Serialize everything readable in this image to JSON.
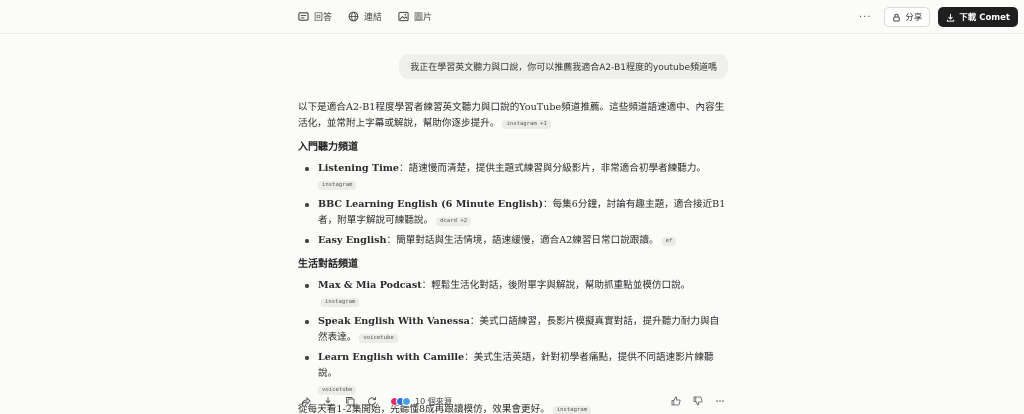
{
  "header": {
    "tabs": [
      {
        "label": "回答",
        "icon": "answer-icon"
      },
      {
        "label": "連結",
        "icon": "globe-icon"
      },
      {
        "label": "圖片",
        "icon": "image-icon"
      }
    ],
    "more_label": "···",
    "share_label": "分享",
    "download_label": "下載 Comet"
  },
  "query": "我正在學習英文聽力與口說，你可以推薦我適合A2-B1程度的youtube頻道嗎",
  "answer": {
    "intro": "以下是適合A2-B1程度學習者練習英文聽力與口說的YouTube頻道推薦。這些頻道語速適中、內容生活化，並常附上字幕或解說，幫助你逐步提升。",
    "intro_cite": "instagram +1",
    "sections": [
      {
        "title": "入門聽力頻道",
        "items": [
          {
            "name": "Listening Time",
            "desc": "：語速慢而清楚，提供主題式練習與分級影片，非常適合初學者練聽力。",
            "cite": "instagram"
          },
          {
            "name": "BBC Learning English (6 Minute English)",
            "desc": "：每集6分鐘，討論有趣主題，適合接近B1者，附單字解說可練聽說。",
            "cite": "dcard +2"
          },
          {
            "name": "Easy English",
            "desc": "：簡單對話與生活情境，語速緩慢，適合A2練習日常口說跟讀。",
            "cite": "ef"
          }
        ]
      },
      {
        "title": "生活對話頻道",
        "items": [
          {
            "name": "Max & Mia Podcast",
            "desc": "：輕鬆生活化對話，後附單字與解說，幫助抓重點並模仿口說。",
            "cite": "instagram"
          },
          {
            "name": "Speak English With Vanessa",
            "desc": "：美式口語練習，長影片模擬真實對話，提升聽力耐力與自然表達。",
            "cite": "voicetube"
          },
          {
            "name": "Learn English with Camille",
            "desc": "：美式生活英語，針對初學者痛點，提供不同語速影片練聽說。",
            "cite": "voicetube"
          }
        ]
      }
    ],
    "closing": "從每天看1-2集開始，先聽懂8成再跟讀模仿，效果會更好。",
    "closing_cite": "instagram"
  },
  "footer": {
    "sources_label": "10 個來源",
    "source_colors": [
      "#e1306c",
      "#2f6fdd",
      "#4aa3df"
    ]
  }
}
